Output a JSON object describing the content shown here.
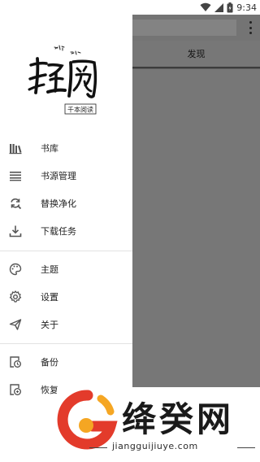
{
  "status_bar": {
    "time": "9:34"
  },
  "app": {
    "tab_label": "发现"
  },
  "drawer": {
    "logo_text": "轻阅",
    "logo_subtitle": "千本阅读",
    "groups": [
      [
        {
          "label": "书库",
          "icon": "library-icon"
        },
        {
          "label": "书源管理",
          "icon": "list-icon"
        },
        {
          "label": "替换净化",
          "icon": "find-replace-icon"
        },
        {
          "label": "下载任务",
          "icon": "download-icon"
        }
      ],
      [
        {
          "label": "主题",
          "icon": "palette-icon"
        },
        {
          "label": "设置",
          "icon": "gear-icon"
        },
        {
          "label": "关于",
          "icon": "send-icon"
        }
      ],
      [
        {
          "label": "备份",
          "icon": "backup-icon"
        },
        {
          "label": "恢复",
          "icon": "restore-icon"
        }
      ]
    ]
  },
  "watermark": {
    "title": "绛癸网",
    "url": "jiangguijiuye.com"
  },
  "colors": {
    "scrim": "#747474",
    "drawer_bg": "#ffffff",
    "watermark_red": "#e33b2b",
    "watermark_orange": "#f5a623"
  }
}
